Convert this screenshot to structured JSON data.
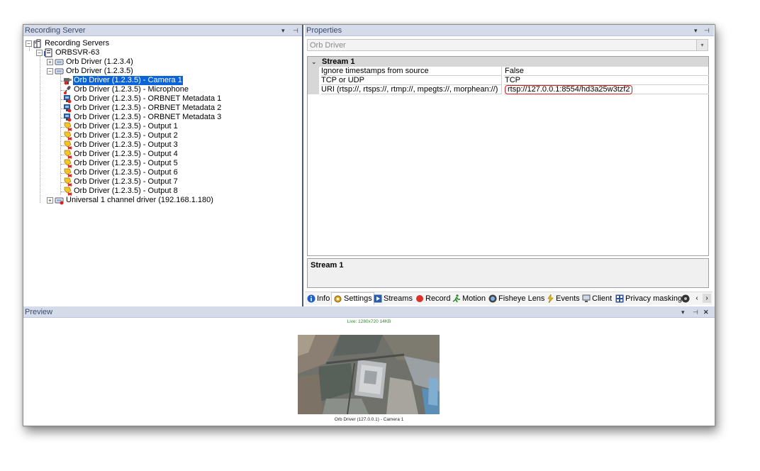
{
  "left_panel": {
    "title": "Recording Server",
    "tree": [
      {
        "label": "Recording Servers",
        "icon": "server-group-icon"
      },
      {
        "label": "ORBSVR-63",
        "icon": "server-icon"
      },
      {
        "label": "Orb Driver (1.2.3.4)",
        "icon": "hardware-icon"
      },
      {
        "label": "Orb Driver (1.2.3.5)",
        "icon": "hardware-icon"
      },
      {
        "label": "Orb Driver (1.2.3.5) - Camera 1",
        "icon": "camera-icon",
        "selected": true
      },
      {
        "label": "Orb Driver (1.2.3.5) - Microphone",
        "icon": "microphone-icon"
      },
      {
        "label": "Orb Driver (1.2.3.5) - ORBNET Metadata 1",
        "icon": "metadata-icon"
      },
      {
        "label": "Orb Driver (1.2.3.5) - ORBNET Metadata 2",
        "icon": "metadata-icon"
      },
      {
        "label": "Orb Driver (1.2.3.5) - ORBNET Metadata 3",
        "icon": "metadata-icon"
      },
      {
        "label": "Orb Driver (1.2.3.5) - Output 1",
        "icon": "output-icon"
      },
      {
        "label": "Orb Driver (1.2.3.5) - Output 2",
        "icon": "output-icon"
      },
      {
        "label": "Orb Driver (1.2.3.5) - Output 3",
        "icon": "output-icon"
      },
      {
        "label": "Orb Driver (1.2.3.5) - Output 4",
        "icon": "output-icon"
      },
      {
        "label": "Orb Driver (1.2.3.5) - Output 5",
        "icon": "output-icon"
      },
      {
        "label": "Orb Driver (1.2.3.5) - Output 6",
        "icon": "output-icon"
      },
      {
        "label": "Orb Driver (1.2.3.5) - Output 7",
        "icon": "output-icon"
      },
      {
        "label": "Orb Driver (1.2.3.5) - Output 8",
        "icon": "output-icon"
      },
      {
        "label": "Universal 1 channel driver (192.168.1.180)",
        "icon": "hardware-disabled-icon"
      }
    ]
  },
  "right_panel": {
    "title": "Properties",
    "dropdown_value": "Orb Driver",
    "category": "Stream 1",
    "properties": [
      {
        "name": "Ignore timestamps from source",
        "value": "False"
      },
      {
        "name": "TCP or UDP",
        "value": "TCP"
      },
      {
        "name": "URI (rtsp://, rtsps://, rtmp://, mpegts://, morphean://)",
        "value": "rtsp://127.0.0.1:8554/hd3a25w3tzf2",
        "highlighted": true
      }
    ],
    "description_title": "Stream 1",
    "tabs": [
      "Info",
      "Settings",
      "Streams",
      "Record",
      "Motion",
      "Fisheye Lens",
      "Events",
      "Client",
      "Privacy masking"
    ],
    "active_tab": "Settings"
  },
  "preview": {
    "title": "Preview",
    "live_status": "Live: 1280x720 14KB",
    "camera_caption": "Orb Driver (127.0.0.1) - Camera 1"
  },
  "colors": {
    "selection": "#0a64d8",
    "titlebar": "#d6dbe9",
    "highlight_border": "#d81f1f",
    "live_text": "#2a8f2a"
  }
}
